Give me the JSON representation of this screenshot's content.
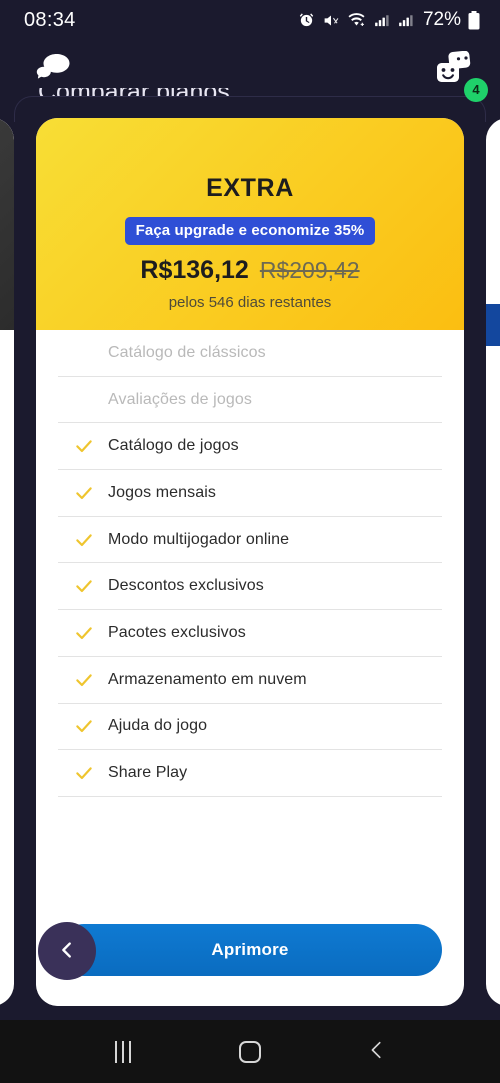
{
  "status_bar": {
    "time": "08:34",
    "battery_percent": "72%",
    "icons": [
      "alarm-icon",
      "mute-icon",
      "wifi-icon",
      "signal-icon",
      "signal-icon",
      "battery-icon"
    ]
  },
  "app_header": {
    "messages_icon": "speech-bubbles-icon",
    "friends_icon": "friends-cards-icon",
    "friends_badge": "4"
  },
  "page": {
    "title": "Comparar planos"
  },
  "plan": {
    "name": "EXTRA",
    "promo_badge": "Faça upgrade e economize 35%",
    "price_new": "R$136,12",
    "price_old": "R$209,42",
    "price_note": "pelos 546 dias restantes"
  },
  "features": [
    {
      "label": "Catálogo de clássicos",
      "included": false
    },
    {
      "label": "Avaliações de jogos",
      "included": false
    },
    {
      "label": "Catálogo de jogos",
      "included": true
    },
    {
      "label": "Jogos mensais",
      "included": true
    },
    {
      "label": "Modo multijogador online",
      "included": true
    },
    {
      "label": "Descontos exclusivos",
      "included": true
    },
    {
      "label": "Pacotes exclusivos",
      "included": true
    },
    {
      "label": "Armazenamento em nuvem",
      "included": true
    },
    {
      "label": "Ajuda do jogo",
      "included": true
    },
    {
      "label": "Share Play",
      "included": true
    }
  ],
  "footer": {
    "cta_label": "Aprimore",
    "back_icon": "chevron-left-icon"
  },
  "android_nav": {
    "recents_icon": "recents-icon",
    "home_icon": "home-icon",
    "back_icon": "back-chevron-icon"
  },
  "colors": {
    "background": "#1b1a2e",
    "card_yellow_from": "#f8de35",
    "card_yellow_to": "#fbbe11",
    "promo_blue": "#2f4fd6",
    "cta_blue": "#0b73ca",
    "fab_purple": "#3a3159",
    "badge_green": "#1fd16a",
    "check_yellow": "#efc52e"
  }
}
